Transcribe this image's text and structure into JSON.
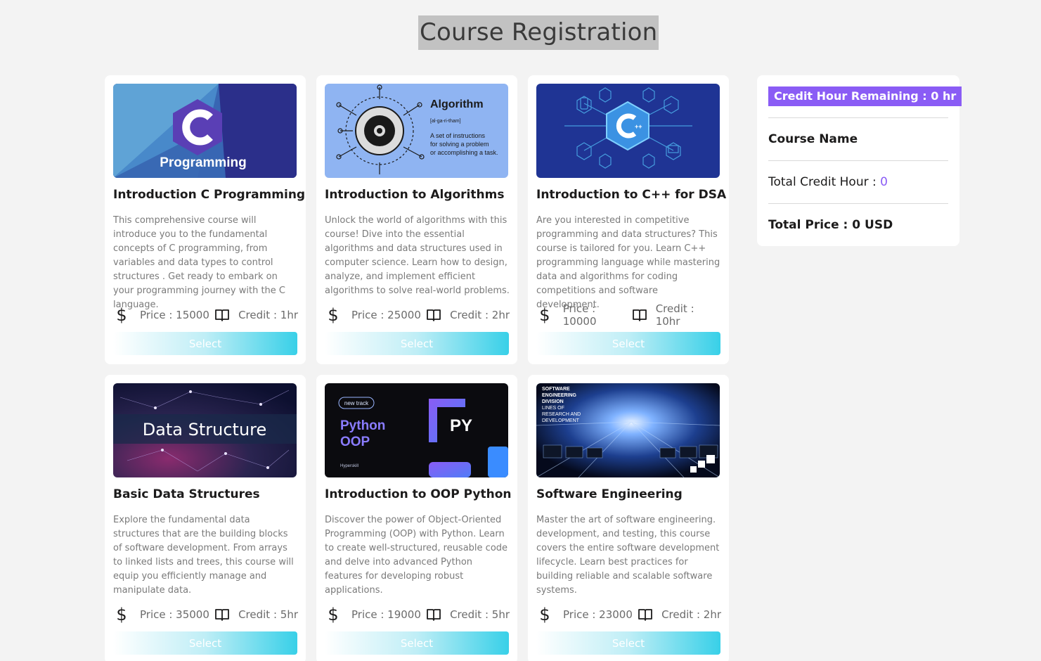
{
  "page": {
    "title": "Course Registration"
  },
  "courses": [
    {
      "title": "Introduction C Programming",
      "description": "This comprehensive course will introduce you to the fundamental concepts of C programming, from variables and data types to control structures . Get ready to embark on your programming journey with the C language.",
      "price_label": "Price : 15000",
      "credit_label": "Credit : 1hr",
      "select_label": "Select",
      "image_text": "Programming"
    },
    {
      "title": "Introduction to Algorithms",
      "description": "Unlock the world of algorithms with this course! Dive into the essential algorithms and data structures used in computer science. Learn how to design, analyze, and implement efficient algorithms to solve real-world problems.",
      "price_label": "Price : 25000",
      "credit_label": "Credit : 2hr",
      "select_label": "Select",
      "image_text": "Algorithm",
      "image_subtext": "[al-ga-ri-tham]",
      "image_caption": [
        "A set of instructions",
        "for solving a problem",
        "or accomplishing a task."
      ]
    },
    {
      "title": "Introduction to C++ for DSA",
      "description": "Are you interested in competitive programming and data structures? This course is tailored for you. Learn C++ programming language while mastering data and algorithms for coding competitions and software development.",
      "price_label": "Price : 10000",
      "credit_label": "Credit : 10hr",
      "select_label": "Select"
    },
    {
      "title": "Basic Data Structures",
      "description": "Explore the fundamental data structures that are the building blocks of software development. From arrays to linked lists and trees, this course will equip you efficiently manage and manipulate data.",
      "price_label": "Price : 35000",
      "credit_label": "Credit : 5hr",
      "select_label": "Select",
      "image_text": "Data Structure"
    },
    {
      "title": "Introduction to OOP Python",
      "description": "Discover the power of Object-Oriented Programming (OOP) with Python. Learn to create well-structured, reusable code and delve into advanced Python features for developing robust applications.",
      "price_label": "Price : 19000",
      "credit_label": "Credit : 5hr",
      "select_label": "Select",
      "image_badge": "new track",
      "image_text": [
        "Python",
        "OOP"
      ],
      "image_logo": "PY",
      "image_brand": "Hyperskill"
    },
    {
      "title": "Software Engineering",
      "description": "Master the art of software engineering. development, and testing, this course covers the entire software development lifecycle. Learn best practices for building reliable and scalable software systems.",
      "price_label": "Price : 23000",
      "credit_label": "Credit : 2hr",
      "select_label": "Select",
      "image_text": [
        "SOFTWARE",
        "ENGINEERING",
        "DIVISION",
        "LINES OF",
        "RESEARCH AND",
        "DEVELOPMENT"
      ]
    }
  ],
  "summary": {
    "credit_remaining_label": "Credit Hour Remaining : 0 hr",
    "course_name_label": "Course Name",
    "total_credit_label": "Total Credit Hour : ",
    "total_credit_value": "0",
    "total_price_label": "Total Price : 0 USD"
  },
  "colors": {
    "accent_purple": "#8a5cf5",
    "button_cyan": "#38d0e8",
    "page_bg": "#f3f3f3"
  },
  "icons": {
    "price": "dollar-icon",
    "credit": "book-icon"
  }
}
